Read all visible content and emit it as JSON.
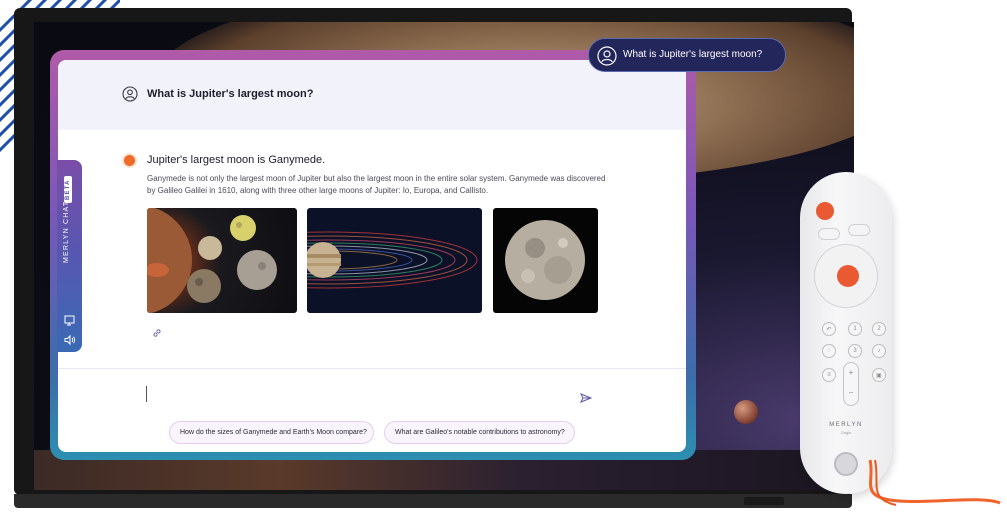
{
  "pill": {
    "text": "What is Jupiter's largest moon?",
    "icon": "user-circle-icon"
  },
  "side_tab": {
    "brand": "MERLYN CHAT",
    "badge": "BETA",
    "icons": [
      "screen-share-icon",
      "speaker-icon"
    ]
  },
  "chat": {
    "question": "What is Jupiter's largest moon?",
    "answer_heading": "Jupiter's largest moon is Ganymede.",
    "answer_body": "Ganymede is not only the largest moon of Jupiter but also the largest moon in the entire solar system. Ganymede was discovered by Galileo Galilei in 1610, along with three other large moons of Jupiter: Io, Europa, and Callisto.",
    "images": [
      "jupiter-moons-image",
      "jupiter-orbits-image",
      "ganymede-image"
    ],
    "input_value": "",
    "suggestions": [
      "How do the sizes of Ganymede and Earth's Moon compare?",
      "What are Galileo's notable contributions to astronomy?"
    ]
  },
  "remote": {
    "brand": "MERLYN",
    "sub": "Origin",
    "keys": [
      "1",
      "2",
      "3"
    ]
  },
  "colors": {
    "accent": "#f06a2a",
    "frame_top": "#b05aa8",
    "frame_bottom": "#2c8fb0",
    "pill_bg": "#23265a"
  }
}
